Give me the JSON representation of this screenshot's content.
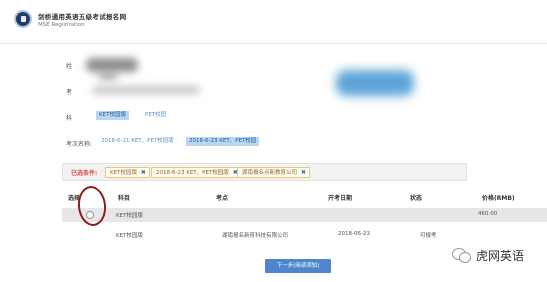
{
  "header": {
    "title": "剑桥通用英语五级考试报名网",
    "subtitle": "MSE Registration"
  },
  "form": {
    "name_label": "姓",
    "id_label": "考",
    "subject_label": "科",
    "subject_options": [
      "KET校园版",
      "PET校园"
    ],
    "session_label": "考次名称:",
    "session_options": [
      "2018-6-21 KET、PET校园版",
      "2018-6-23 KET、PET校园"
    ]
  },
  "filters": {
    "label": "已选条件:",
    "chips": [
      "KET校园版",
      "2018-6-23 KET、PET校园版",
      "湖南报名点新教育公司"
    ],
    "close_symbol": "✖"
  },
  "table": {
    "headers": [
      "选择",
      "科目",
      "考点",
      "开考日期",
      "状态",
      "价格(RMB)"
    ],
    "rows": [
      {
        "subject": "KET校园版",
        "site": "",
        "date": "",
        "status": "",
        "price": "460.00"
      },
      {
        "subject": "KET校园版",
        "site": "湖南报名新育科技有限公司",
        "date": "2018-06-23",
        "status": "可报考",
        "price": ""
      }
    ]
  },
  "next_button": "下一步(阅读须知)",
  "watermark": {
    "text": "虎网英语",
    "icon": "wechat-icon"
  }
}
